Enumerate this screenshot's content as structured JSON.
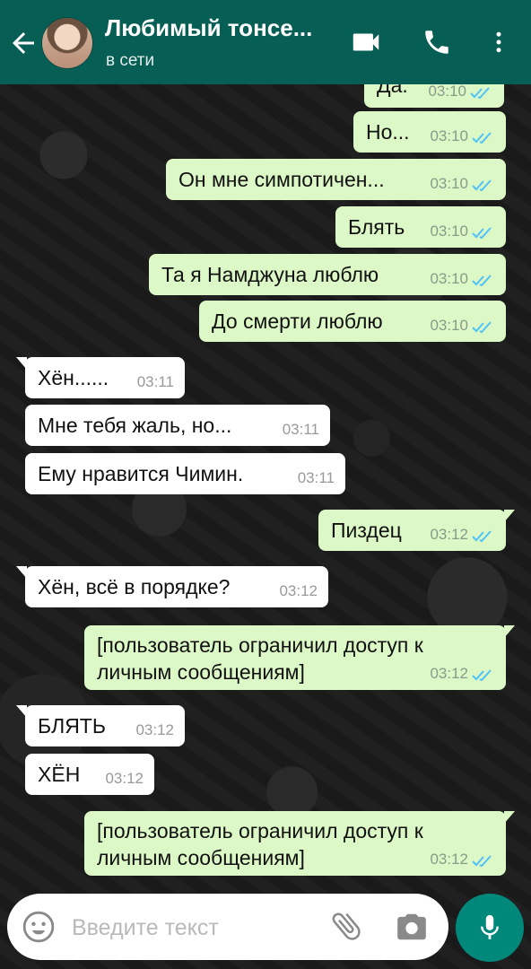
{
  "header": {
    "contact_name": "Любимый тонсе...",
    "status": "в сети"
  },
  "messages": [
    {
      "dir": "out",
      "text": "Да.",
      "time": "03:10",
      "read": true
    },
    {
      "dir": "out",
      "text": "Но...",
      "time": "03:10",
      "read": true
    },
    {
      "dir": "out",
      "text": "Он мне симпотичен...",
      "time": "03:10",
      "read": true
    },
    {
      "dir": "out",
      "text": "Блять",
      "time": "03:10",
      "read": true
    },
    {
      "dir": "out",
      "text": "Та я Намджуна люблю",
      "time": "03:10",
      "read": true
    },
    {
      "dir": "out",
      "text": "До смерти люблю",
      "time": "03:10",
      "read": true
    },
    {
      "dir": "in",
      "text": "Хён......",
      "time": "03:11"
    },
    {
      "dir": "in",
      "text": "Мне тебя жаль, но...",
      "time": "03:11"
    },
    {
      "dir": "in",
      "text": "Ему нравится Чимин.",
      "time": "03:11"
    },
    {
      "dir": "out",
      "text": "Пиздец",
      "time": "03:12",
      "read": true
    },
    {
      "dir": "in",
      "text": "Хён, всё в порядке?",
      "time": "03:12"
    },
    {
      "dir": "out",
      "text": "[пользователь ограничил доступ к личным сообщениям]",
      "time": "03:12",
      "read": true
    },
    {
      "dir": "in",
      "text": "БЛЯТЬ",
      "time": "03:12"
    },
    {
      "dir": "in",
      "text": "ХЁН",
      "time": "03:12"
    },
    {
      "dir": "out",
      "text": "[пользователь ограничил доступ к личным сообщениям]",
      "time": "03:12",
      "read": true
    }
  ],
  "composer": {
    "placeholder": "Введите текст"
  },
  "colors": {
    "header": "#075e54",
    "outgoing_bubble": "#dcf8c6",
    "incoming_bubble": "#ffffff",
    "read_tick": "#4fc3f7",
    "mic_button": "#00897b"
  },
  "icons": [
    "back-arrow-icon",
    "video-call-icon",
    "phone-icon",
    "more-vert-icon",
    "double-check-icon",
    "emoji-icon",
    "attach-icon",
    "camera-icon",
    "mic-icon"
  ]
}
